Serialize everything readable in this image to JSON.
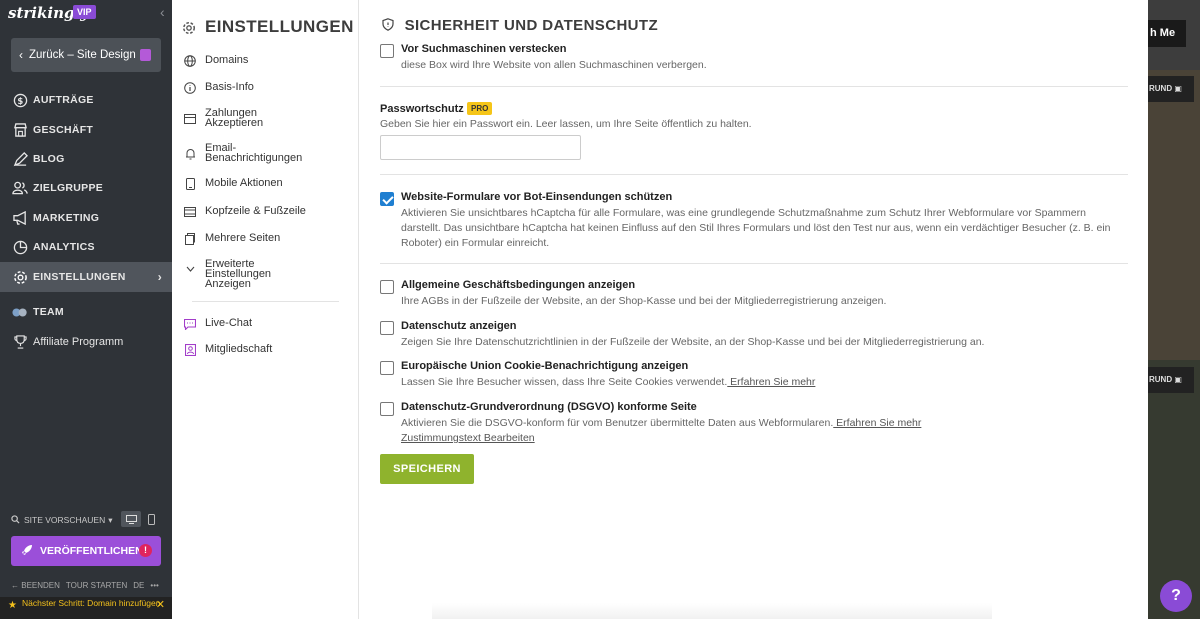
{
  "app": {
    "logo": "strikingly",
    "badge": "VIP"
  },
  "sidebar": {
    "back_label": "Zurück – Site Design",
    "items": [
      {
        "label": "AUFTRÄGE",
        "icon": "dollar-circle-icon"
      },
      {
        "label": "GESCHÄFT",
        "icon": "store-icon"
      },
      {
        "label": "BLOG",
        "icon": "pen-icon"
      },
      {
        "label": "ZIELGRUPPE",
        "icon": "people-icon"
      },
      {
        "label": "MARKETING",
        "icon": "megaphone-icon"
      },
      {
        "label": "ANALYTICS",
        "icon": "chart-icon"
      },
      {
        "label": "EINSTELLUNGEN",
        "icon": "gear-icon",
        "active": true
      },
      {
        "label": "TEAM",
        "icon": "team-icon"
      },
      {
        "label": "Affiliate Programm",
        "icon": "trophy-icon"
      }
    ],
    "preview_label": "SITE VORSCHAUEN",
    "publish_label": "VERÖFFENTLICHEN",
    "publish_warning": "!",
    "bottom_links": [
      "BEENDEN",
      "TOUR STARTEN",
      "DE",
      "•••"
    ],
    "next_step": "Nächster Schritt: Domain hinzufügen"
  },
  "settings_nav": {
    "title": "EINSTELLUNGEN",
    "items": [
      {
        "label": "Domains",
        "icon": "globe-icon"
      },
      {
        "label": "Basis-Info",
        "icon": "info-icon"
      },
      {
        "label": "Zahlungen Akzeptieren",
        "icon": "card-icon"
      },
      {
        "label": "Email-Benachrichtigungen",
        "icon": "bell-icon"
      },
      {
        "label": "Mobile Aktionen",
        "icon": "mobile-icon"
      },
      {
        "label": "Kopfzeile & Fußzeile",
        "icon": "layout-icon"
      },
      {
        "label": "Mehrere Seiten",
        "icon": "pages-icon"
      },
      {
        "label": "Erweiterte Einstellungen Anzeigen",
        "icon": "chevron-down-icon"
      },
      {
        "label": "Live-Chat",
        "icon": "chat-icon"
      },
      {
        "label": "Mitgliedschaft",
        "icon": "member-icon"
      }
    ]
  },
  "section": {
    "title": "SICHERHEIT UND DATENSCHUTZ",
    "hide_search": {
      "label": "Vor Suchmaschinen verstecken",
      "desc": "diese Box wird Ihre Website von allen Suchmaschinen verbergen.",
      "checked": false
    },
    "password": {
      "label": "Passwortschutz",
      "badge": "PRO",
      "desc": "Geben Sie hier ein Passwort ein. Leer lassen, um Ihre Seite öffentlich zu halten.",
      "value": ""
    },
    "bot_protect": {
      "label": "Website-Formulare vor Bot-Einsendungen schützen",
      "desc": "Aktivieren Sie unsichtbares hCaptcha für alle Formulare, was eine grundlegende Schutzmaßnahme zum Schutz Ihrer Webformulare vor Spammern darstellt. Das unsichtbare hCaptcha hat keinen Einfluss auf den Stil Ihres Formulars und löst den Test nur aus, wenn ein verdächtiger Besucher (z. B. ein Roboter) ein Formular einreicht.",
      "checked": true
    },
    "terms": {
      "label": "Allgemeine Geschäftsbedingungen anzeigen",
      "desc": "Ihre AGBs in der Fußzeile der Website, an der Shop-Kasse und bei der Mitgliederregistrierung anzeigen.",
      "checked": false
    },
    "privacy": {
      "label": "Datenschutz anzeigen",
      "desc": "Zeigen Sie Ihre Datenschutzrichtlinien in der Fußzeile der Website, an der Shop-Kasse und bei der Mitgliederregistrierung an.",
      "checked": false
    },
    "cookie": {
      "label": "Europäische Union Cookie-Benachrichtigung anzeigen",
      "desc": "Lassen Sie Ihre Besucher wissen, dass Ihre Seite Cookies verwendet.",
      "link": " Erfahren Sie mehr",
      "checked": false
    },
    "gdpr": {
      "label": "Datenschutz-Grundverordnung (DSGVO) konforme Seite",
      "desc": "Aktivieren Sie die DSGVO-konform für vom Benutzer übermittelte Daten aus Webformularen.",
      "link": " Erfahren Sie mehr",
      "link2": "Zustimmungstext Bearbeiten",
      "checked": false
    },
    "save_label": "SPEICHERN"
  },
  "preview": {
    "button": "h Me",
    "tag1": "RUND",
    "tag2": "RUND"
  },
  "help_label": "?",
  "colors": {
    "sidebar_bg": "#2f3338",
    "accent_purple": "#9b4fd9",
    "save_green": "#8fb32d",
    "checkbox_blue": "#1f7fd1",
    "pro_yellow": "#f5c518"
  }
}
